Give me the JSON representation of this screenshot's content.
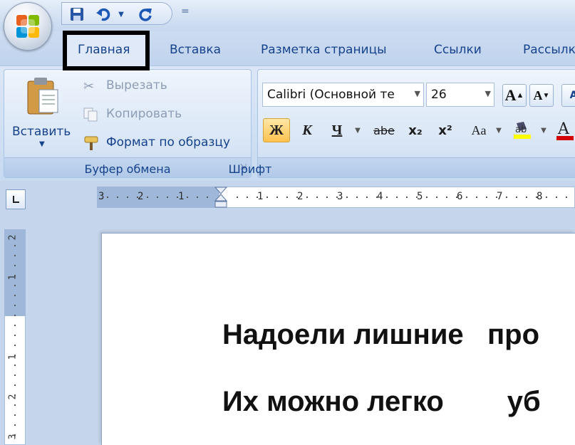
{
  "quick_access": {
    "save_icon": "save-icon",
    "undo_icon": "undo-icon",
    "redo_icon": "redo-icon",
    "more": "="
  },
  "tabs": [
    {
      "label": "Главная",
      "active": true
    },
    {
      "label": "Вставка"
    },
    {
      "label": "Разметка страницы"
    },
    {
      "label": "Ссылки"
    },
    {
      "label": "Рассылк"
    }
  ],
  "clipboard": {
    "paste_label": "Вставить",
    "cut_label": "Вырезать",
    "copy_label": "Копировать",
    "format_painter_label": "Формат по образцу",
    "group_label": "Буфер обмена"
  },
  "font": {
    "font_name": "Calibri (Основной те",
    "font_size": "26",
    "bold_glyph": "Ж",
    "italic_glyph": "К",
    "underline_glyph": "Ч",
    "strike_glyph": "abe",
    "subscript_glyph": "x₂",
    "superscript_glyph": "x²",
    "case_glyph": "Aa",
    "grow_glyph": "A",
    "shrink_glyph": "A",
    "group_label": "Шрифт",
    "bold_active": true
  },
  "ruler": {
    "left_numbers": [
      "3",
      "2",
      "1"
    ],
    "right_numbers": [
      "1",
      "2",
      "3",
      "4",
      "5",
      "6",
      "7",
      "8"
    ],
    "vertical_numbers": [
      "2",
      "1",
      "1",
      "2",
      "3"
    ]
  },
  "document": {
    "line1": "Надоели лишние   про",
    "line2": "Их можно легко        уб"
  },
  "colors": {
    "accent": "#15428b",
    "highlight": "#000000",
    "active_button": "#ffd37a"
  }
}
